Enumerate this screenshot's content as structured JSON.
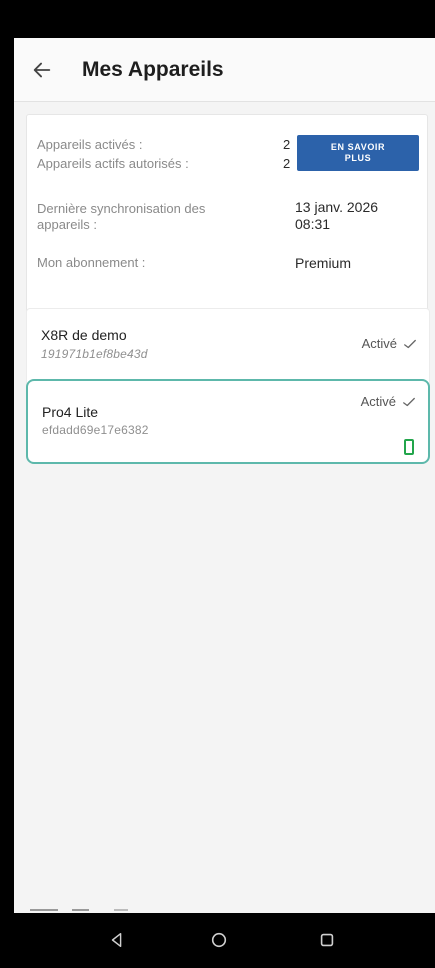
{
  "appbar": {
    "title": "Mes Appareils",
    "back_icon": "arrow-left-icon"
  },
  "summary": {
    "activated_label": "Appareils activés :",
    "activated_value": "2",
    "authorized_label": "Appareils actifs autorisés :",
    "authorized_value": "2",
    "learn_more_label": "EN SAVOIR PLUS",
    "last_sync_label": "Dernière synchronisation des appareils :",
    "last_sync_value": "13 janv. 2026 08:31",
    "subscription_label": "Mon abonnement :",
    "subscription_value": "Premium"
  },
  "devices": [
    {
      "name": "X8R de demo",
      "id": "191971b1ef8be43d",
      "status": "Activé",
      "status_icon": "check-icon",
      "selected": false
    },
    {
      "name": "Pro4 Lite",
      "id": "efdadd69e17e6382",
      "status": "Activé",
      "status_icon": "check-icon",
      "selected": true,
      "extra_icon": "smartphone-icon"
    }
  ],
  "colors": {
    "accent_button": "#2c62aa",
    "selected_border": "#5db8ab",
    "phone_icon": "#22a54b"
  },
  "navbar": {
    "back": "triangle-back-icon",
    "home": "circle-home-icon",
    "recents": "square-recents-icon"
  }
}
